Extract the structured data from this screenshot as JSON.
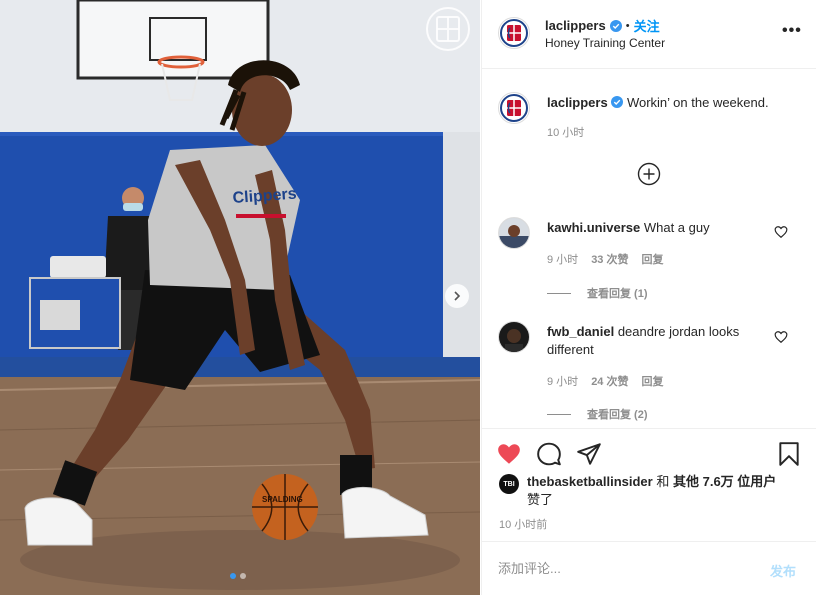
{
  "post": {
    "username": "laclippers",
    "follow_label": "关注",
    "separator": "•",
    "location": "Honey Training Center",
    "more_icon": "more-horizontal-icon"
  },
  "caption": {
    "username": "laclippers",
    "text": "Workin’ on the weekend.",
    "time": "10 小时"
  },
  "comments": [
    {
      "username": "kawhi.universe",
      "text": "What a guy",
      "time": "9 小时",
      "likes": "33 次赞",
      "reply_label": "回复",
      "view_replies": "查看回复 (1)"
    },
    {
      "username": "fwb_daniel",
      "text": "deandre jordan looks different",
      "time": "9 小时",
      "likes": "24 次赞",
      "reply_label": "回复",
      "view_replies": "查看回复 (2)"
    }
  ],
  "liked_by": {
    "avatar_text": "TBI",
    "user": "thebasketballinsider",
    "and": "和",
    "others": "其他 7.6万 位用户",
    "suffix": "赞了"
  },
  "posted_time": "10 小时前",
  "add_comment": {
    "placeholder": "添加评论...",
    "post_label": "发布"
  },
  "media": {
    "carousel_count": 2,
    "carousel_active": 1,
    "ball_text": "SPALDING",
    "jersey_text": "Clippers"
  },
  "colors": {
    "accent": "#0095f6",
    "like_red": "#ed4956",
    "clippers_red": "#c8102e",
    "clippers_blue": "#1d428a"
  }
}
